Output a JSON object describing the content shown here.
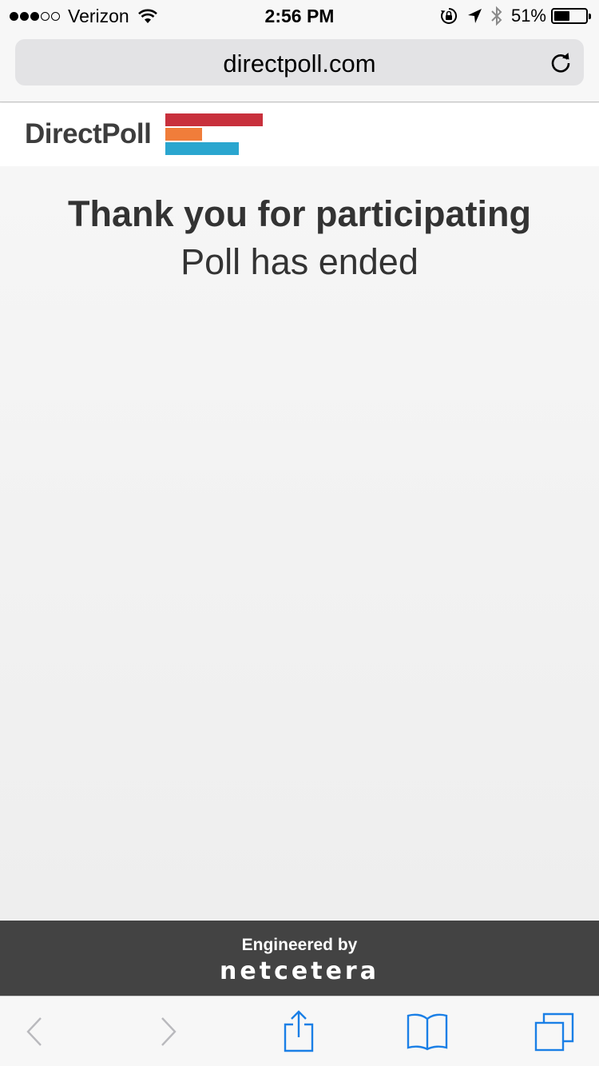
{
  "status_bar": {
    "signal_bars_filled": 3,
    "signal_bars_total": 5,
    "carrier": "Verizon",
    "time": "2:56 PM",
    "battery_percent_label": "51%",
    "battery_level": 0.51,
    "icons": [
      "wifi-icon",
      "rotation-lock-icon",
      "location-arrow-icon",
      "bluetooth-icon",
      "battery-icon"
    ]
  },
  "browser": {
    "url": "directpoll.com",
    "reload_icon": "reload-icon"
  },
  "site": {
    "logo_text": "DirectPoll",
    "logo_bar_colors": [
      "#c8303c",
      "#f07d3a",
      "#2aa6cf"
    ],
    "logo_bar_levels": [
      1.0,
      0.38,
      0.75
    ]
  },
  "main": {
    "heading": "Thank you for participating",
    "subheading": "Poll has ended"
  },
  "footer": {
    "engineered_label": "Engineered by",
    "brand": "netcetera"
  },
  "toolbar": {
    "items": [
      "back-icon",
      "forward-icon",
      "share-icon",
      "bookmarks-icon",
      "tabs-icon"
    ],
    "accent_color": "#1a7fe6",
    "disabled_color": "#b9b9bd"
  }
}
